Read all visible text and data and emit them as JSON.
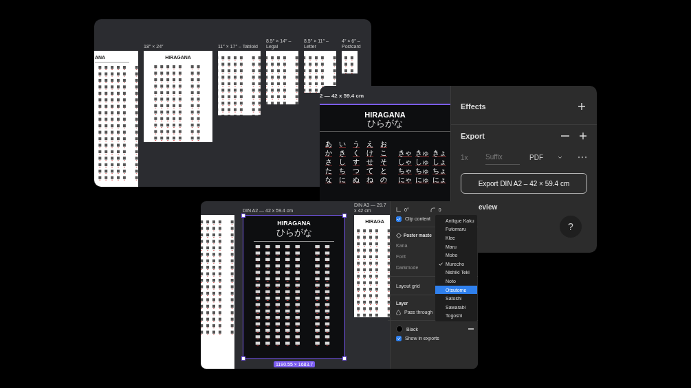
{
  "overview_window": {
    "frames": [
      {
        "title": "ANA"
      },
      {
        "label": "18″ × 24″",
        "title": "HIRAGANA"
      },
      {
        "label": "11″ × 17″ – Tabloid"
      },
      {
        "label": "8.5″ × 14″ – Legal"
      },
      {
        "label": "8.5″ × 11″ – Letter"
      },
      {
        "label": "4″ × 6″ – Postcard"
      }
    ]
  },
  "export_window": {
    "frame_label": "2 — 42 x 59.4 cm",
    "poster": {
      "title": "HIRAGANA",
      "subtitle": "ひらがな",
      "rows": [
        {
          "monographs": [
            "あ",
            "い",
            "う",
            "え",
            "お"
          ]
        },
        {
          "monographs": [
            "か",
            "き",
            "く",
            "け",
            "こ"
          ],
          "digraphs": [
            "きゃ",
            "きゅ",
            "きょ"
          ]
        },
        {
          "monographs": [
            "さ",
            "し",
            "す",
            "せ",
            "そ"
          ],
          "digraphs": [
            "しゃ",
            "しゅ",
            "しょ"
          ]
        },
        {
          "monographs": [
            "た",
            "ち",
            "つ",
            "て",
            "と"
          ],
          "digraphs": [
            "ちゃ",
            "ちゅ",
            "ちょ"
          ]
        },
        {
          "monographs": [
            "な",
            "に",
            "ぬ",
            "ね",
            "の"
          ],
          "digraphs": [
            "にゃ",
            "にゅ",
            "にょ"
          ]
        }
      ]
    },
    "effects": {
      "title": "Effects"
    },
    "export": {
      "title": "Export",
      "scale": "1x",
      "suffix_placeholder": "Suffix",
      "format": "PDF",
      "button": "Export DIN A2 – 42 × 59.4 cm",
      "preview": "eview"
    },
    "help": "?"
  },
  "editor_window": {
    "frames": [
      {
        "kind": "light",
        "selected": false
      },
      {
        "label": "DIN A2 — 42 x 59.4 cm",
        "kind": "dark",
        "selected": true,
        "title": "HIRAGANA",
        "subtitle": "ひらがな",
        "size": "1190.55 × 1683.7"
      },
      {
        "label": "DIN A3 — 29.7 x 42 cm",
        "kind": "light",
        "selected": false,
        "title": "HIRAGA"
      }
    ],
    "properties": {
      "rotation": "0°",
      "radius": "0",
      "clip_content": {
        "label": "Clip content",
        "checked": true
      },
      "component": "Poster maste",
      "props": [
        "Kana",
        "Font",
        "Darkmode"
      ],
      "layout_grid": "Layout grid",
      "layer": {
        "title": "Layer",
        "blend": "Pass through"
      },
      "fill": {
        "name": "Black",
        "color": "#000000"
      },
      "show_in_exports": {
        "label": "Show in exports",
        "checked": true
      }
    }
  },
  "font_menu": {
    "items": [
      {
        "label": "Antique Kaku",
        "checked": false,
        "selected": false
      },
      {
        "label": "Futomaru",
        "checked": false,
        "selected": false
      },
      {
        "label": "Klee",
        "checked": false,
        "selected": false
      },
      {
        "label": "Maru",
        "checked": false,
        "selected": false
      },
      {
        "label": "Mobo",
        "checked": false,
        "selected": false
      },
      {
        "label": "Murecho",
        "checked": true,
        "selected": false
      },
      {
        "label": "Nishiki Teki",
        "checked": false,
        "selected": false
      },
      {
        "label": "Noto",
        "checked": false,
        "selected": false
      },
      {
        "label": "Otsutome",
        "checked": false,
        "selected": true
      },
      {
        "label": "Satoshi",
        "checked": false,
        "selected": false
      },
      {
        "label": "Sawarabi",
        "checked": false,
        "selected": false
      },
      {
        "label": "Togoshi",
        "checked": false,
        "selected": false
      }
    ]
  }
}
